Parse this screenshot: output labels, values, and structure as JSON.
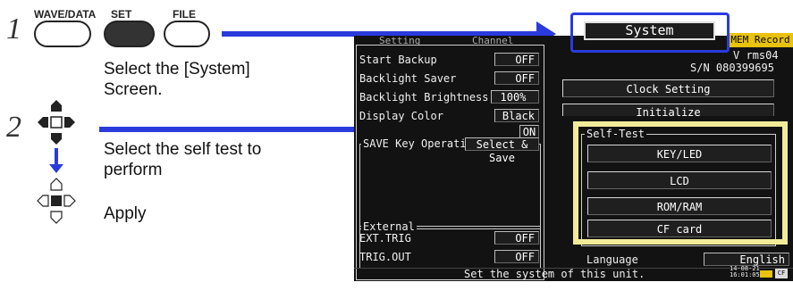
{
  "steps": [
    {
      "number": "1",
      "description": "Select the [System]\nScreen."
    },
    {
      "number": "2",
      "description": "Select the self test to\nperform"
    }
  ],
  "keys": {
    "wave_data": "WAVE/DATA",
    "set": "SET",
    "file": "FILE"
  },
  "apply_label": "Apply",
  "screen": {
    "tabs_hidden": [
      "Setting",
      "Channel"
    ],
    "system_tab": "System",
    "mode_badge": "MEM Record",
    "model_line": "V rms04",
    "serial": "S/N 080399695",
    "settings": [
      {
        "label": "Start Backup",
        "value": "OFF"
      },
      {
        "label": "Backlight Saver",
        "value": "OFF"
      },
      {
        "label": "Backlight Brightness",
        "value": "100%"
      },
      {
        "label": "Display Color",
        "value": "Black"
      },
      {
        "label": "",
        "value": "ON"
      }
    ],
    "save_key": {
      "title": "SAVE Key Operation",
      "value": "Select & Save"
    },
    "external": {
      "title": "External",
      "items": [
        {
          "label": "EXT.TRIG",
          "value": "OFF"
        },
        {
          "label": "TRIG.OUT",
          "value": "OFF"
        }
      ]
    },
    "right_buttons": {
      "clock": "Clock Setting",
      "initialize": "Initialize"
    },
    "self_test": {
      "title": "Self-Test",
      "buttons": [
        "KEY/LED",
        "LCD",
        "ROM/RAM",
        "CF card"
      ]
    },
    "language": {
      "label": "Language",
      "value": "English"
    },
    "status_message": "Set the system of this unit.",
    "clock_readout": "14-08-21\n16:01:05",
    "cf_indicator": "CF"
  },
  "colors": {
    "arrow": "#2a3bdc",
    "highlight_yellow": "#f2ec9a",
    "screen_bg": "#121212"
  }
}
